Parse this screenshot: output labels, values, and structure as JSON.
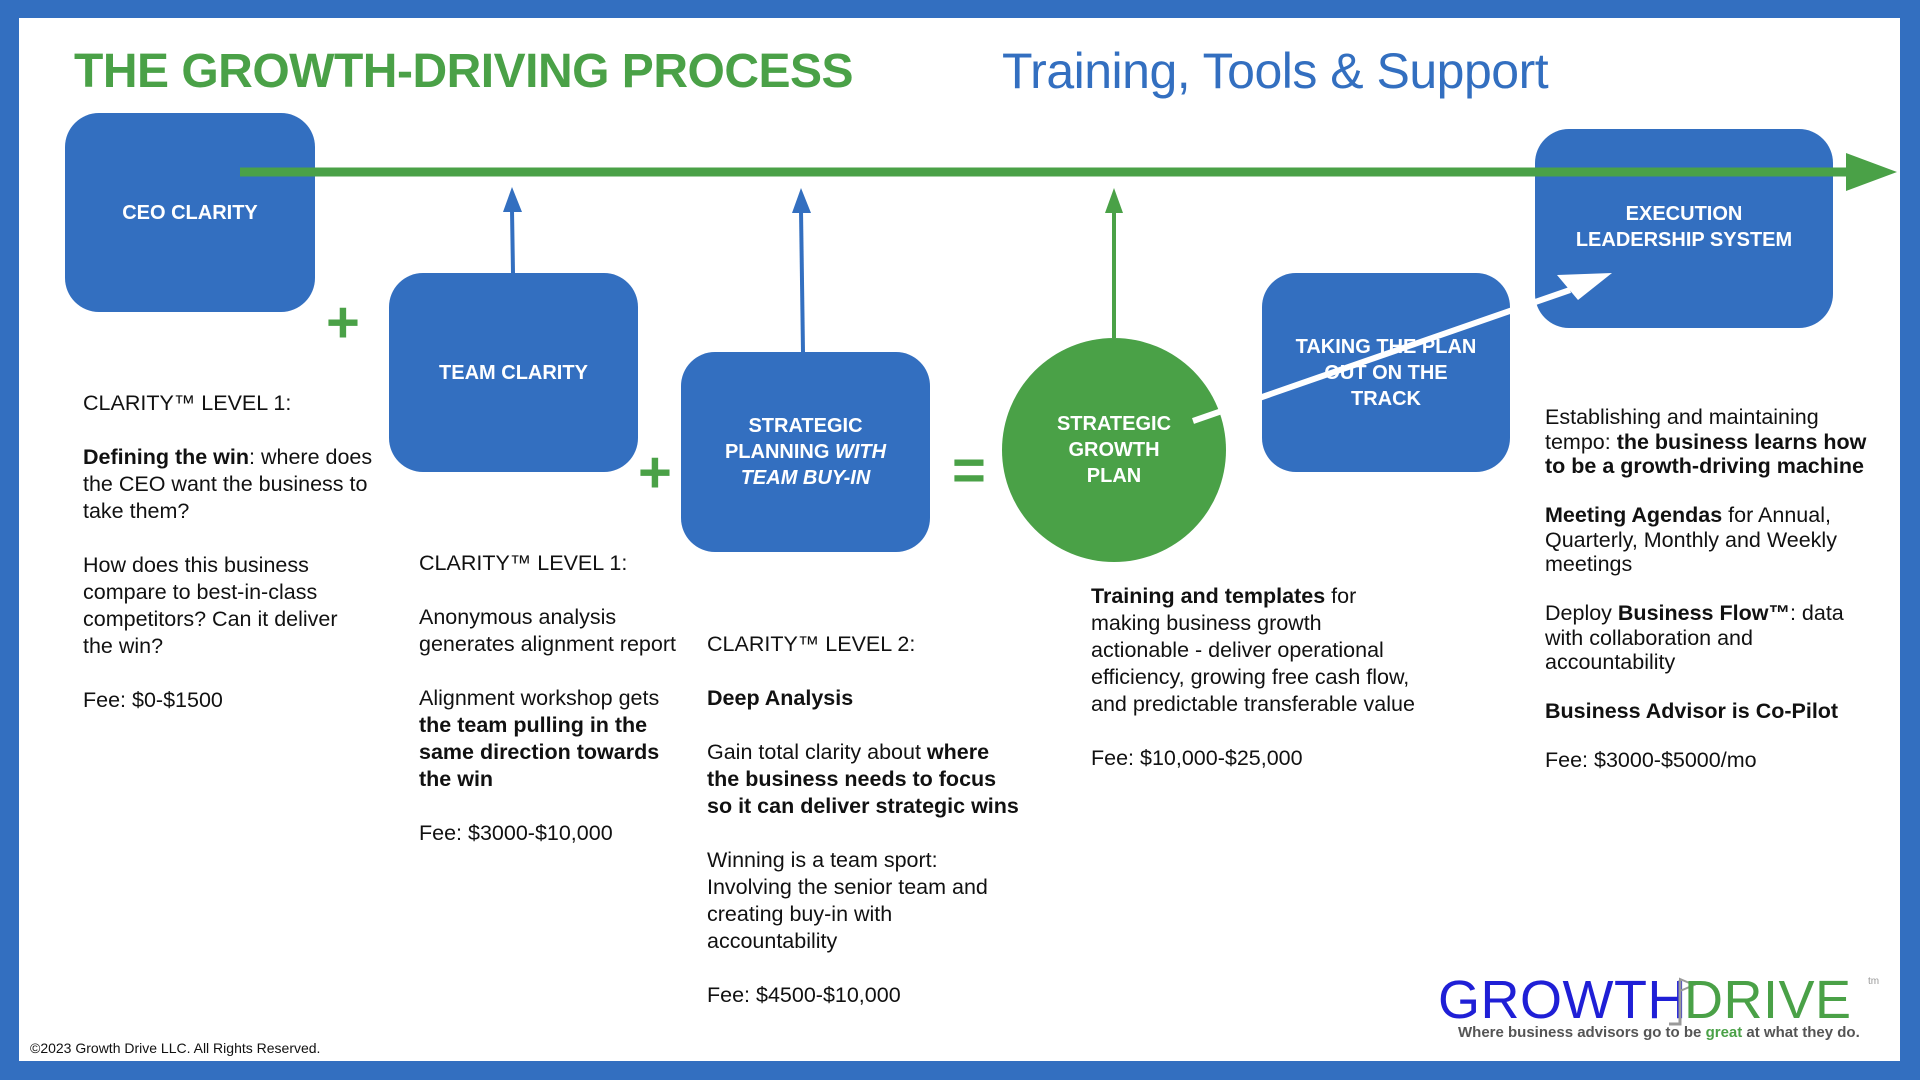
{
  "header": {
    "title": "THE GROWTH-DRIVING PROCESS",
    "subtitle": "Training, Tools & Support"
  },
  "colors": {
    "brand_blue": "#336fc0",
    "brand_green": "#4aa147",
    "logo_blue": "#1f1fd6",
    "text": "#111111"
  },
  "stages": {
    "ceo": {
      "label": "CEO CLARITY"
    },
    "team": {
      "label": "TEAM CLARITY"
    },
    "strategic": {
      "line1": "STRATEGIC",
      "line2a": "PLANNING ",
      "line2b": "WITH",
      "line3": "TEAM BUY-IN"
    },
    "plan": {
      "line1": "STRATEGIC",
      "line2": "GROWTH",
      "line3": "PLAN"
    },
    "track": {
      "line1": "TAKING THE PLAN",
      "line2": "OUT ON THE",
      "line3": "TRACK"
    },
    "execution": {
      "line1": "EXECUTION",
      "line2": "LEADERSHIP SYSTEM"
    }
  },
  "operators": {
    "plus": "+",
    "equals": "="
  },
  "columns": {
    "ceo": {
      "heading": "CLARITY™ LEVEL 1:",
      "p1_bold": "Defining the win",
      "p1_rest": ": where does the CEO want the business to take them?",
      "p2": "How does this business compare to best-in-class competitors? Can it deliver the win?",
      "fee": "Fee: $0-$1500"
    },
    "team": {
      "heading": "CLARITY™ LEVEL 1:",
      "p1": "Anonymous analysis generates alignment report",
      "p2_lead": "Alignment workshop gets ",
      "p2_bold": "the team pulling in the same direction towards the win",
      "fee": "Fee: $3000-$10,000"
    },
    "strategic": {
      "heading": "CLARITY™ LEVEL 2:",
      "subheading": "Deep Analysis",
      "p1_lead": "Gain total clarity about ",
      "p1_bold": "where the business needs to focus so it can deliver strategic wins",
      "p2": "Winning is a team sport: Involving the senior team and creating buy-in with accountability",
      "fee": "Fee: $4500-$10,000"
    },
    "plan": {
      "p1_bold": "Training and templates",
      "p1_rest": " for making business growth actionable - deliver operational efficiency, growing free cash flow, and predictable transferable value",
      "fee": "Fee: $10,000-$25,000"
    },
    "execution": {
      "p1_lead": "Establishing and maintaining tempo: ",
      "p1_bold": "the business learns how to be a growth-driving machine",
      "p2_bold": "Meeting Agendas",
      "p2_rest": " for Annual, Quarterly, Monthly and Weekly meetings",
      "p3_lead": "Deploy ",
      "p3_bold": "Business Flow™",
      "p3_rest": ": data with collaboration and accountability",
      "p4_bold": "Business Advisor is Co-Pilot",
      "fee": "Fee: $3000-$5000/mo"
    }
  },
  "footer": {
    "copyright": "©2023 Growth Drive LLC. All Rights Reserved."
  },
  "logo": {
    "word1": "GROWTH",
    "word2": "DRIVE",
    "tm": "tm",
    "tagline_lead": "Where business advisors go to be ",
    "tagline_accent": "great",
    "tagline_tail": " at what they do."
  }
}
